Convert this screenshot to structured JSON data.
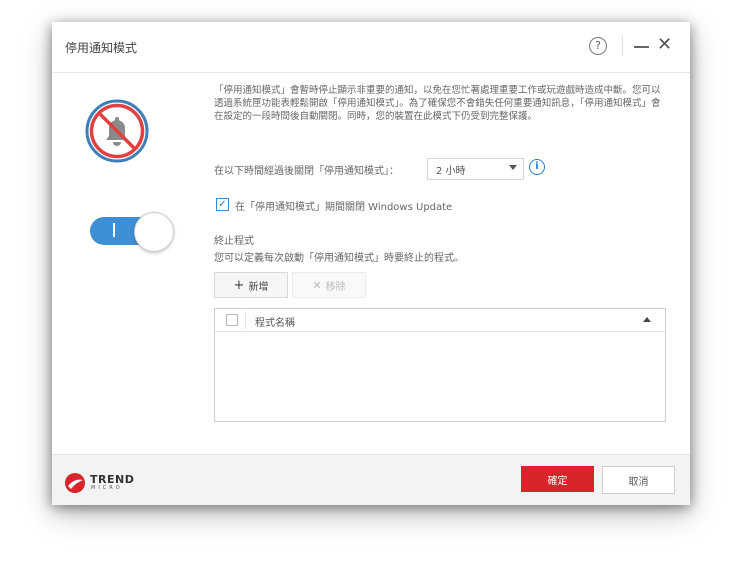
{
  "window": {
    "title": "停用通知模式",
    "help_label": "?",
    "close_label": "✕"
  },
  "content": {
    "description": "「停用通知模式」會暫時停止顯示非重要的通知，以免在您忙著處理重要工作或玩遊戲時造成中斷。您可以透過系統匣功能表輕鬆開啟「停用通知模式」。為了確保您不會錯失任何重要通知訊息，「停用通知模式」會在設定的一段時間後自動關閉。同時，您的裝置在此模式下仍受到完整保護。",
    "timer_label": "在以下時間經過後關閉「停用通知模式」：",
    "timer_value": "2 小時",
    "info_label": "i",
    "windows_update_checked": true,
    "windows_update_label": "在「停用通知模式」期間關閉 Windows Update",
    "blocked_title": "終止程式",
    "blocked_desc": "您可以定義每次啟動「停用通知模式」時要終止的程式。",
    "add_button": "新增",
    "remove_button": "移除",
    "table_header": "程式名稱"
  },
  "toggle": {
    "on": true
  },
  "footer": {
    "logo_text": "TREND",
    "logo_sub": "MICRO",
    "ok_button": "確定",
    "cancel_button": "取消"
  },
  "colors": {
    "accent_blue": "#3f8fd4",
    "primary_red": "#d9242b",
    "badge_ring_blue": "#3d7fb8"
  }
}
